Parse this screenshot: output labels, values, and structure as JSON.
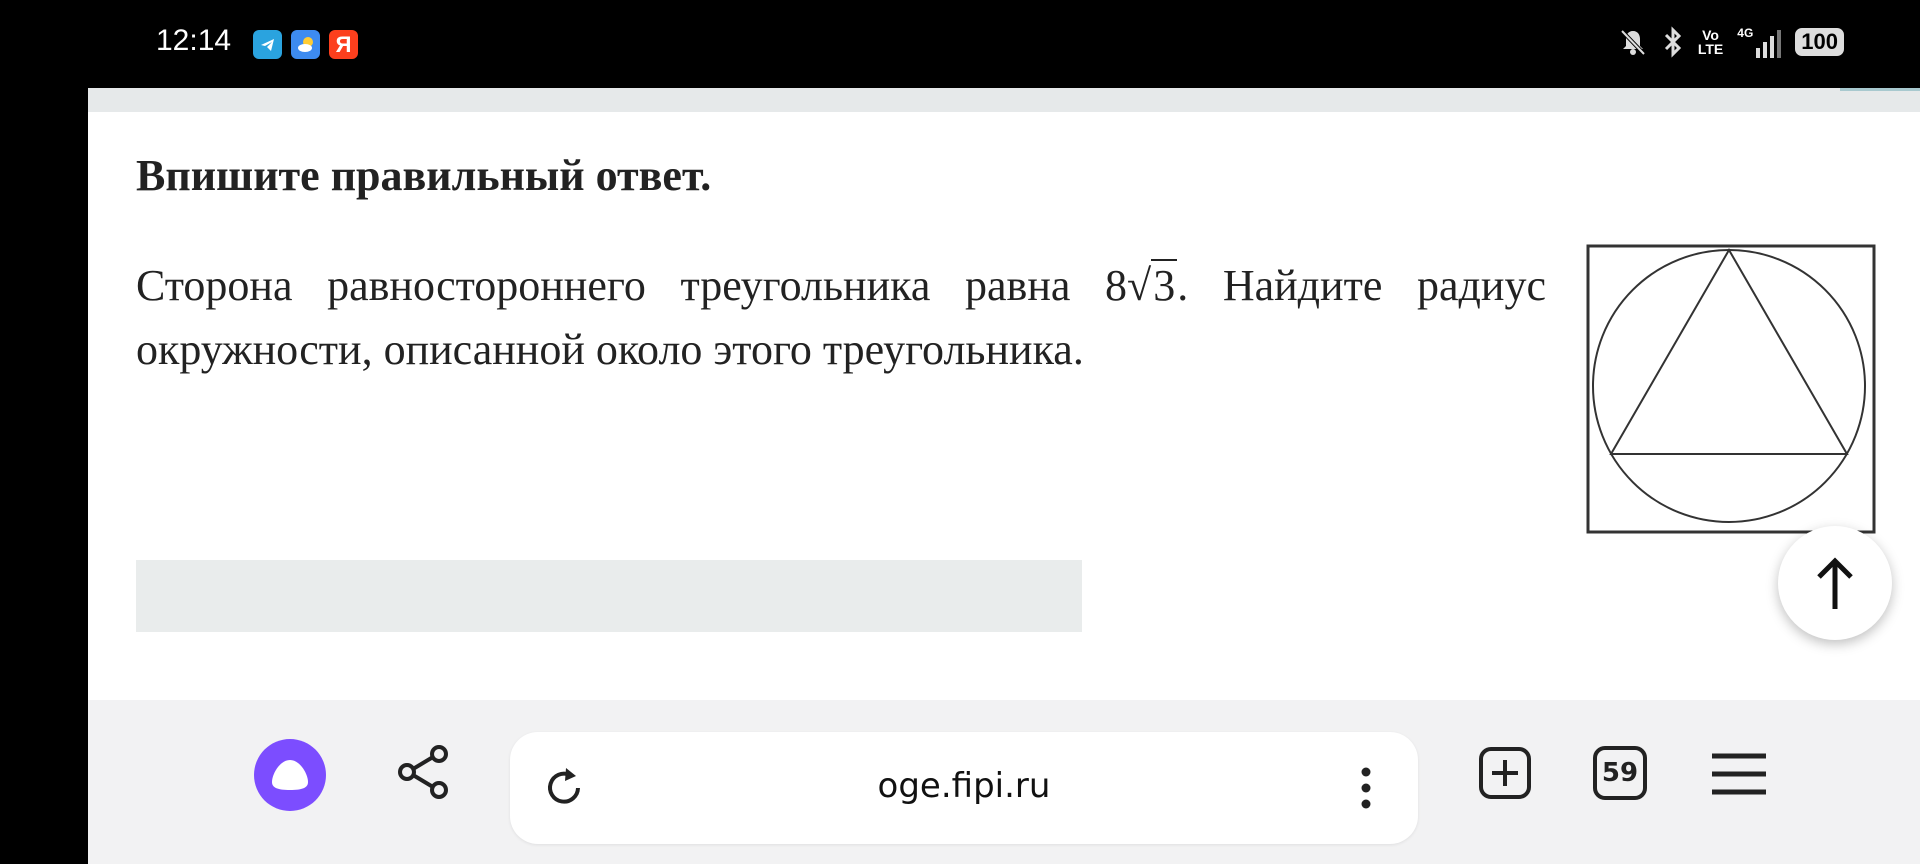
{
  "status_bar": {
    "time": "12:14",
    "notification_icons": [
      "telegram-icon",
      "weather-icon",
      "yandex-icon"
    ],
    "yandex_letter": "Я",
    "volte_top": "Vo",
    "volte_bottom": "LTE",
    "network": "4G",
    "battery": "100"
  },
  "task": {
    "instruction": "Впишите правильный ответ.",
    "text_before": "Сторона равностороннего треугольника равна 8",
    "sqrt_value": "3",
    "text_after": ". Найдите радиус окружности, описанной около этого треугольника.",
    "answer_value": ""
  },
  "toolbar": {
    "url": "oge.fipi.ru",
    "tabs_count": "59"
  },
  "colors": {
    "alice": "#7c4dff",
    "telegram": "#2aa3df",
    "yandex": "#fc3f1d",
    "weather": "#3d8bf0"
  }
}
